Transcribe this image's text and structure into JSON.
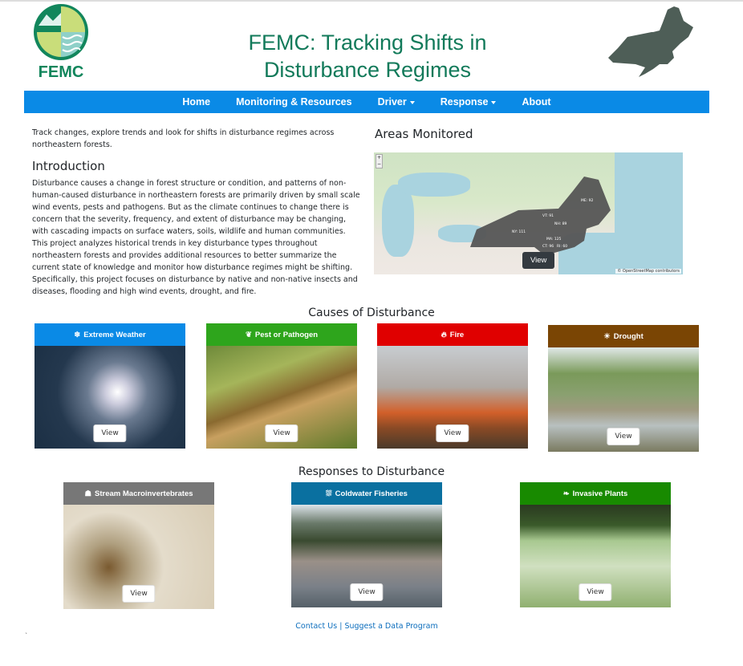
{
  "header": {
    "title_line1": "FEMC: Tracking Shifts in",
    "title_line2": "Disturbance Regimes",
    "logo_text": "FEMC"
  },
  "nav": {
    "items": [
      {
        "label": "Home"
      },
      {
        "label": "Monitoring & Resources"
      },
      {
        "label": "Driver",
        "dropdown": true
      },
      {
        "label": "Response",
        "dropdown": true
      },
      {
        "label": "About"
      }
    ],
    "color": "#0a8ae6"
  },
  "intro": {
    "tagline": "Track changes, explore trends and look for shifts in disturbance regimes across northeastern forests.",
    "heading": "Introduction",
    "body": "Disturbance causes a change in forest structure or condition, and patterns of non-human-caused disturbance in northeastern forests are primarily driven by small scale wind events, pests and pathogens.  But as the climate continues to change there is concern that the severity,  frequency, and extent of disturbance may be changing, with cascading impacts on surface waters, soils, wildlife and human communities. This project analyzes historical trends in key disturbance types throughout northeastern forests and provides additional resources to better summarize the current state of knowledge and monitor how disturbance regimes might be shifting. Specifically, this project focuses on disturbance by native and non-native insects and diseases, flooding and high wind events, drought, and fire."
  },
  "areas": {
    "heading": "Areas Monitored",
    "view_label": "View",
    "attribution": "© OpenStreetMap contributors",
    "states": [
      "ME: 92",
      "VT: 91",
      "NH: 89",
      "NY: 111",
      "MA: 125",
      "CT: 96",
      "RI: 60"
    ]
  },
  "causes": {
    "heading": "Causes of Disturbance",
    "cards": [
      {
        "label": "Extreme Weather",
        "icon": "snowflake-icon",
        "color": "#0a8ae6",
        "view": "View"
      },
      {
        "label": "Pest or Pathogen",
        "icon": "leaf-bug-icon",
        "color": "#2ea51c",
        "view": "View"
      },
      {
        "label": "Fire",
        "icon": "fire-icon",
        "color": "#e00000",
        "view": "View"
      },
      {
        "label": "Drought",
        "icon": "sun-icon",
        "color": "#7a4504",
        "view": "View"
      }
    ]
  },
  "responses": {
    "heading": "Responses to Disturbance",
    "cards": [
      {
        "label": "Stream Macroinvertebrates",
        "icon": "insect-icon",
        "color": "#777777",
        "view": "View"
      },
      {
        "label": "Coldwater Fisheries",
        "icon": "fish-icon",
        "color": "#0a70a0",
        "view": "View"
      },
      {
        "label": "Invasive Plants",
        "icon": "sprout-icon",
        "color": "#188a00",
        "view": "View"
      }
    ]
  },
  "footer": {
    "contact": "Contact Us",
    "separator": "|",
    "suggest": "Suggest a Data Program",
    "tick": "`"
  }
}
